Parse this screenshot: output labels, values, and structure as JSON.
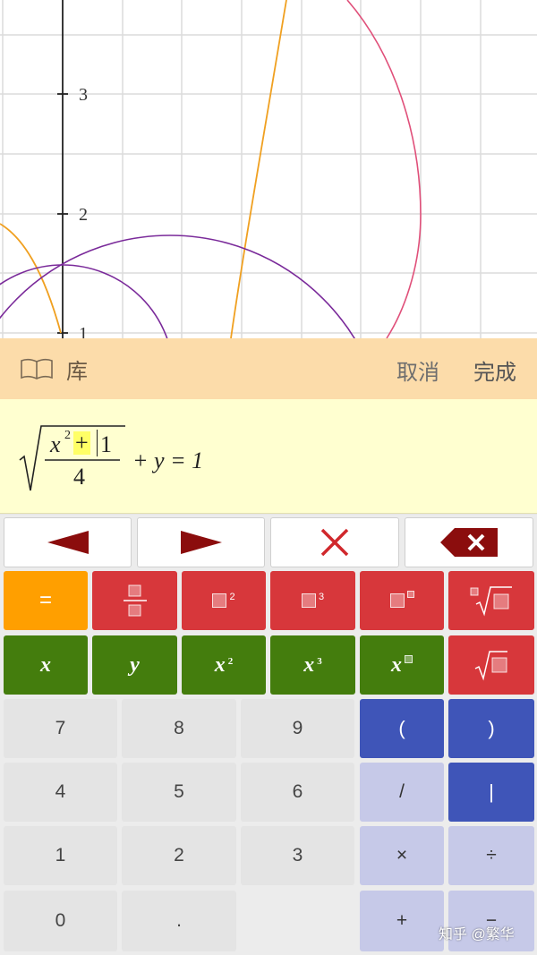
{
  "graph": {
    "y_ticks": [
      "3",
      "2",
      "1"
    ]
  },
  "toolbar": {
    "library_label": "库",
    "cancel_label": "取消",
    "done_label": "完成"
  },
  "editor": {
    "numerator_base": "x",
    "numerator_exp": "2",
    "plus_sign": "+",
    "numerator_const": "1",
    "denominator": "4",
    "rest": "+ y = 1"
  },
  "keyboard": {
    "equals": "=",
    "var_x": "x",
    "var_y": "y",
    "x_base": "x",
    "exp_2": "2",
    "exp_3": "3",
    "digits": [
      "7",
      "8",
      "9",
      "4",
      "5",
      "6",
      "1",
      "2",
      "3",
      "0",
      "."
    ],
    "open_paren": "(",
    "close_paren": ")",
    "slash": "/",
    "abs_bar": "|",
    "times": "×",
    "divide": "÷",
    "plus": "+",
    "minus": "−"
  },
  "watermark": "知乎 @繁华",
  "colors": {
    "toolbar_bg": "#fcdcaa",
    "editor_bg": "#ffffd0",
    "red_key": "#d7373b",
    "green_key": "#447d0d",
    "orange_key": "#ff9f00",
    "blue_key": "#3f55b8",
    "lavender_key": "#c6c9e8",
    "curve_orange": "#f0a020",
    "curve_purple": "#7a2a9a",
    "curve_pink": "#e0507a"
  }
}
